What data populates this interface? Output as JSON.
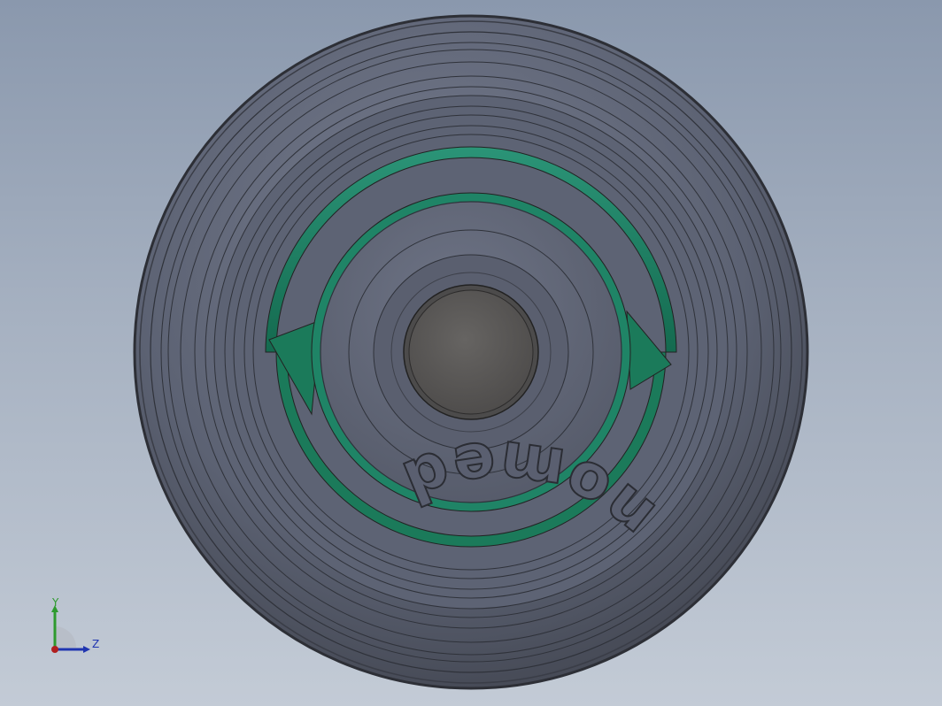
{
  "model": {
    "embossed_text": "nomed"
  },
  "triad": {
    "y_label": "Y",
    "z_label": "Z"
  },
  "colors": {
    "background_top": "#8a98ad",
    "background_bottom": "#c3cbd6",
    "wheel_body": "#5f6577",
    "wheel_edge": "#3a3d47",
    "accent_green": "#1f8a66",
    "axle": "#5c5a59",
    "y_axis": "#2e9a2e",
    "z_axis": "#1f35b0",
    "x_axis": "#b01f1f"
  },
  "icons": {
    "triad": "coordinate-triad-icon"
  }
}
